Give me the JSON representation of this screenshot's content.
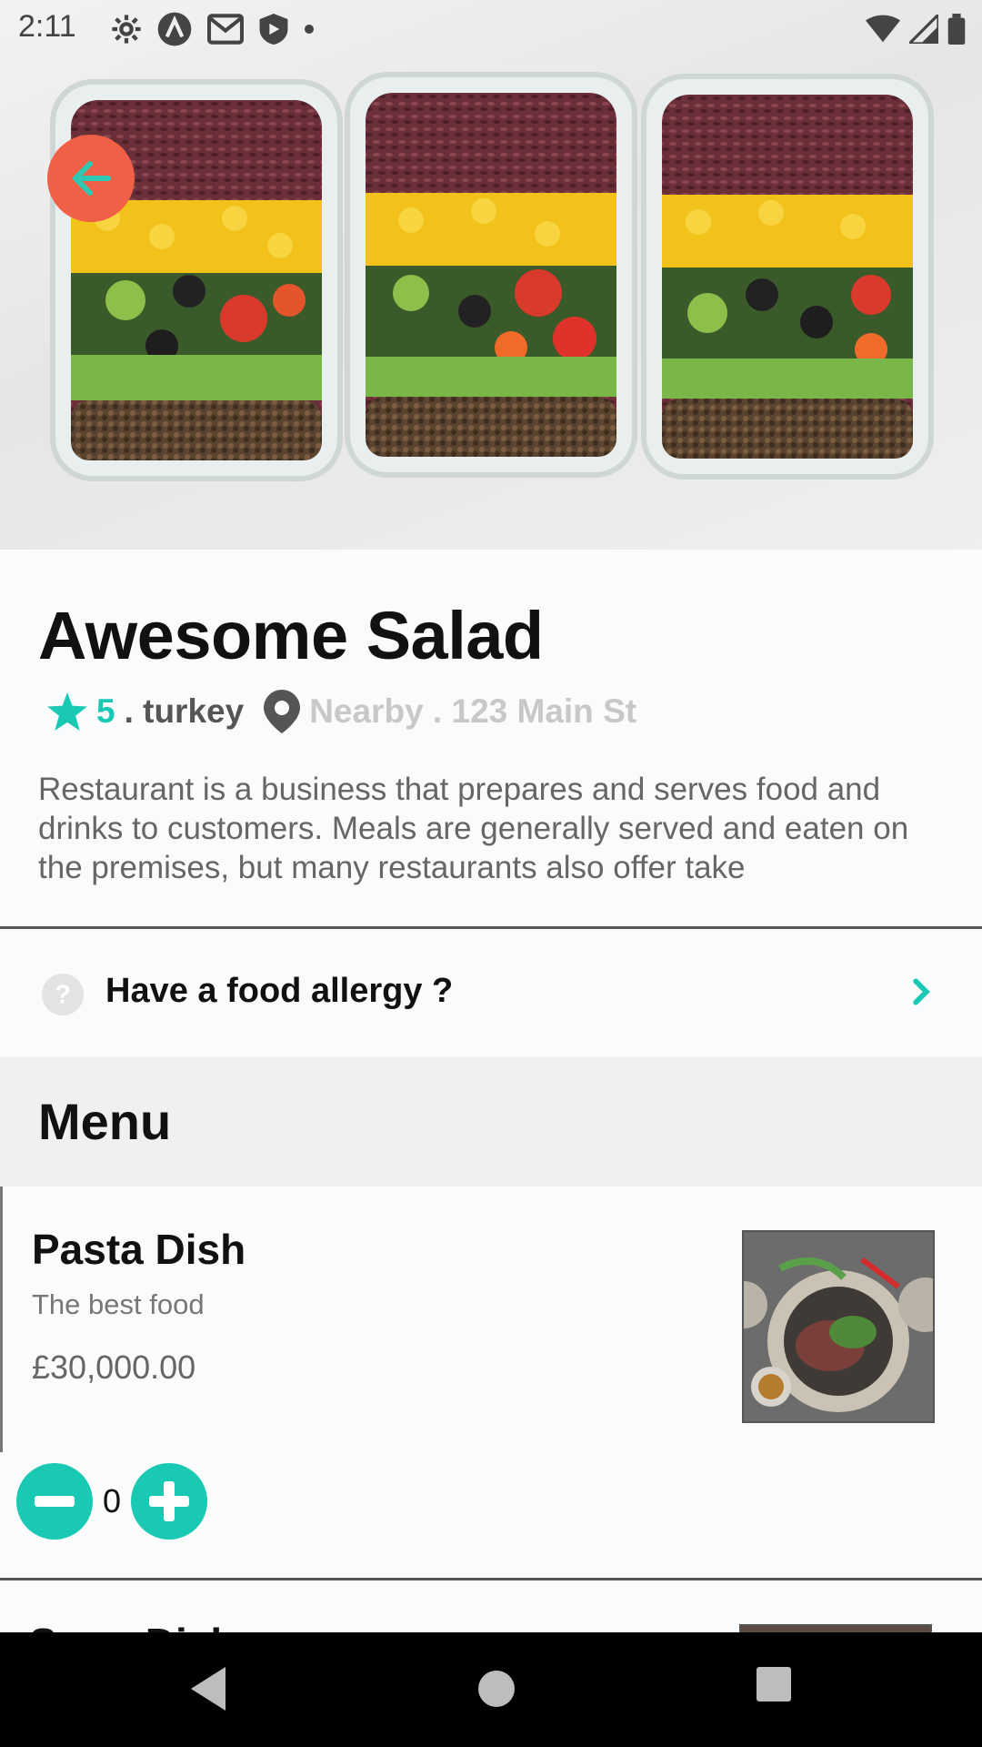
{
  "status_bar": {
    "time": "2:11",
    "left_icons": [
      "settings-icon",
      "artifact-icon",
      "gmail-icon",
      "shield-play-icon",
      "dot-icon"
    ],
    "right_icons": [
      "wifi-icon",
      "signal-icon",
      "battery-icon"
    ]
  },
  "colors": {
    "accent": "#1ac9b4",
    "back_button": "#f06046",
    "hero_bg": "#e8e8e8"
  },
  "restaurant": {
    "name": "Awesome Salad",
    "rating": "5",
    "country": ". turkey",
    "location": "Nearby . 123 Main St",
    "description": "Restaurant is a business that prepares and serves food and drinks to customers. Meals are generally served and eaten on the premises, but many restaurants also offer take"
  },
  "allergy": {
    "label": "Have a food allergy ?"
  },
  "menu": {
    "title": "Menu",
    "items": [
      {
        "name": "Pasta Dish",
        "description": "The best food",
        "price": "£30,000.00",
        "quantity": "0"
      },
      {
        "name": "Soup Dish"
      }
    ]
  }
}
